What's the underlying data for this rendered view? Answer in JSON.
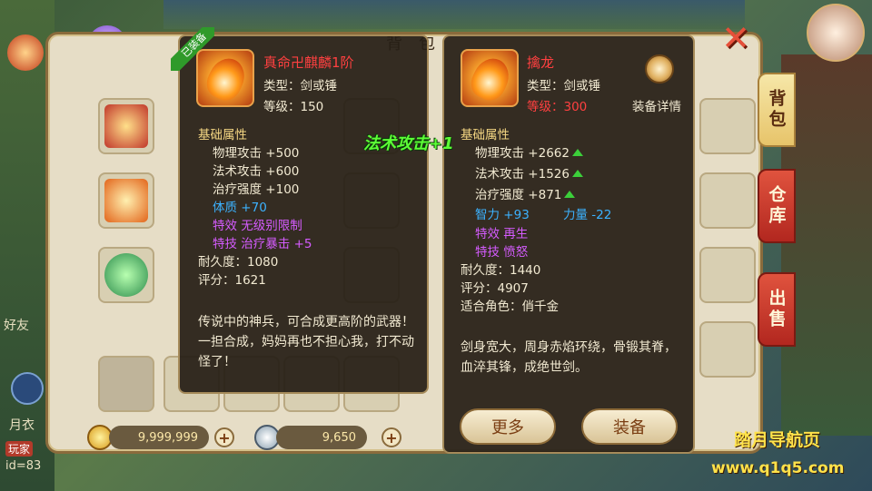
{
  "header": {
    "title": "背包"
  },
  "tabs": [
    {
      "label": "背包",
      "active": true
    },
    {
      "label": "仓库",
      "active": false
    },
    {
      "label": "出售",
      "active": false
    }
  ],
  "equipped_tooltip": {
    "badge": "已装备",
    "name": "真命卍麒麟1阶",
    "type_line": "类型：剑或锤",
    "level_line": "等级：150",
    "base_header": "基础属性",
    "attrs": [
      "物理攻击  +500",
      "法术攻击  +600",
      "治疗强度  +100"
    ],
    "constitution": "体质  +70",
    "special_effect": "特效  无级别限制",
    "special_skill": "特技  治疗暴击  +5",
    "durability": "耐久度：1080",
    "score": "评分：1621",
    "description": "传说中的神兵，可合成更高阶的武器！一担合成，妈妈再也不担心我，打不动怪了！"
  },
  "compare_tooltip": {
    "name": "擒龙",
    "type_line": "类型：剑或锤",
    "level_line": "等级：300",
    "detail_label": "装备详情",
    "base_header": "基础属性",
    "attrs": [
      "物理攻击  +2662",
      "法术攻击  +1526",
      "治疗强度  +871"
    ],
    "intellect": "智力  +93",
    "strength": "力量  -22",
    "special_effect": "特效  再生",
    "special_skill": "特技  愤怒",
    "durability": "耐久度：1440",
    "score": "评分：4907",
    "suitable": "适合角色：俏千金",
    "description": "剑身宽大，周身赤焰环绕，骨锻其脊，血淬其锋，成绝世剑。",
    "more_label": "更多",
    "equip_label": "装备"
  },
  "floating_text": "法术攻击+1",
  "currency": {
    "gold": "9,999,999",
    "silver": "9,650"
  },
  "left_chat": {
    "friend_label": "好友",
    "player_name": "月衣",
    "sect_label": "玩家",
    "id_label": "id=83"
  },
  "watermark": {
    "name": "踏月导航页",
    "url": "www.q1q5.com"
  },
  "colors": {
    "panel_bg": "#e6ddc6",
    "tooltip_bg": "#261e16",
    "red_tab": "#c43222",
    "accent_gold": "#f5d783",
    "stat_up": "#3ccf3a"
  }
}
